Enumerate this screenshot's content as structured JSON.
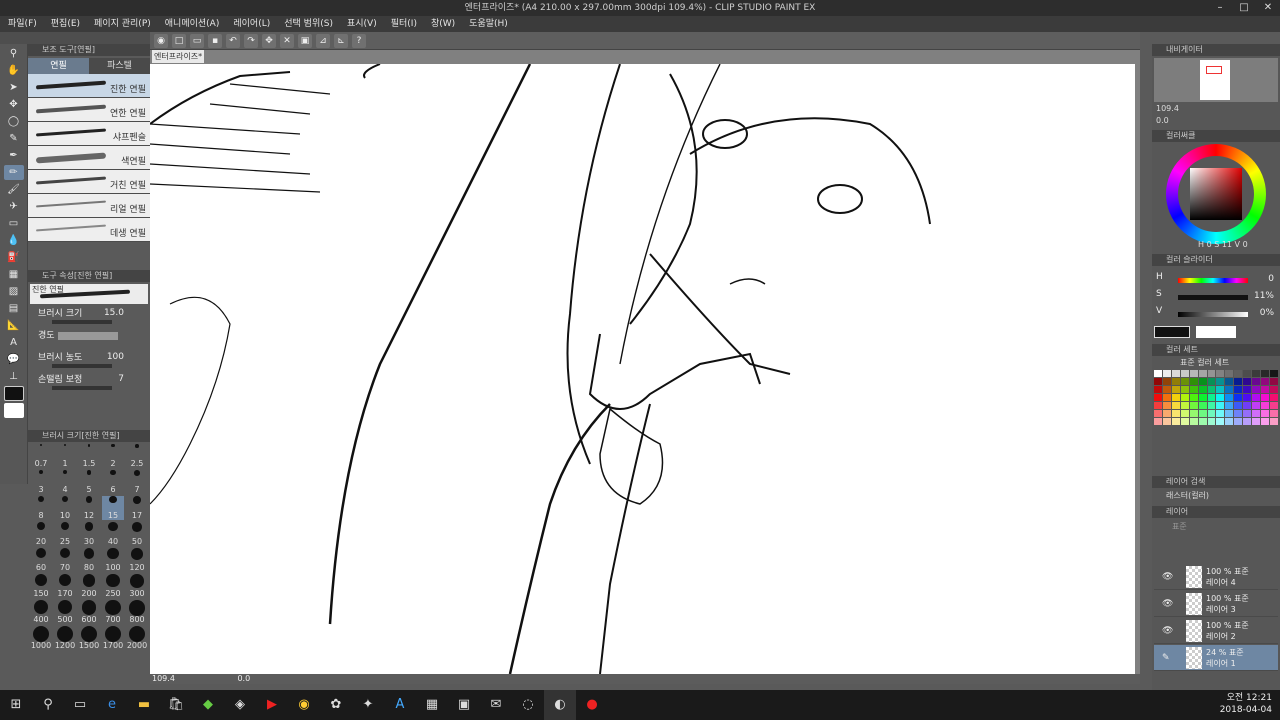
{
  "window": {
    "title": "엔터프라이즈* (A4 210.00 x 297.00mm 300dpi 109.4%) - CLIP STUDIO PAINT EX"
  },
  "menu": [
    "파일(F)",
    "편집(E)",
    "페이지 관리(P)",
    "애니메이션(A)",
    "레이어(L)",
    "선택 범위(S)",
    "표시(V)",
    "필터(I)",
    "창(W)",
    "도움말(H)"
  ],
  "subtool": {
    "title": "보조 도구[연필]",
    "tabs": [
      "연필",
      "파스텔"
    ],
    "brushes": [
      "진한 연필",
      "연한 연필",
      "샤프펜슬",
      "색연필",
      "거친 연필",
      "리얼 연필",
      "데생 연필"
    ]
  },
  "toolprop": {
    "title": "도구 속성[진한 연필]",
    "brush_name": "진한 연필",
    "size_label": "브러시 크기",
    "size_value": "15.0",
    "hardness_label": "경도",
    "density_label": "브러시 농도",
    "density_value": "100",
    "stab_label": "손떨림 보정",
    "stab_value": "7"
  },
  "brushsize": {
    "title": "브러시 크기[진한 연필]",
    "sizes": [
      "0.7",
      "1",
      "1.5",
      "2",
      "2.5",
      "3",
      "4",
      "5",
      "6",
      "7",
      "8",
      "10",
      "12",
      "15",
      "17",
      "20",
      "25",
      "30",
      "40",
      "50",
      "60",
      "70",
      "80",
      "100",
      "120",
      "150",
      "170",
      "200",
      "250",
      "300",
      "400",
      "500",
      "600",
      "700",
      "800",
      "1000",
      "1200",
      "1500",
      "1700",
      "2000"
    ],
    "selected": "15"
  },
  "document": {
    "tab": "엔터프라이즈*"
  },
  "status": {
    "zoom": "109.4",
    "angle": "0.0"
  },
  "navigator": {
    "title": "내비게이터",
    "zoom": "109.4",
    "angle": "0.0"
  },
  "color_wheel": {
    "title": "컬러써클",
    "h": "0",
    "s": "11",
    "v": "0"
  },
  "color_slider": {
    "title": "컬러 슬라이더",
    "h": "0",
    "s": "11%",
    "v": "0%"
  },
  "color_set": {
    "title": "컬러 세트",
    "set_name": "표준 컬러 세트"
  },
  "layer_search": {
    "title": "레이어 검색",
    "mode": "래스터(컬러)"
  },
  "layers": {
    "title": "레이어",
    "blend": "표준",
    "items": [
      {
        "opacity": "100 % 표준",
        "name": "레이어 4"
      },
      {
        "opacity": "100 % 표준",
        "name": "레이어 3"
      },
      {
        "opacity": "100 % 표준",
        "name": "레이어 2"
      },
      {
        "opacity": "24 % 표준",
        "name": "레이어 1"
      }
    ]
  },
  "taskbar": {
    "time": "오전 12:21",
    "date": "2018-04-04"
  },
  "colors": {
    "accent": "#6e87a3",
    "canvas": "#ffffff",
    "ui": "#5a5a5a"
  }
}
